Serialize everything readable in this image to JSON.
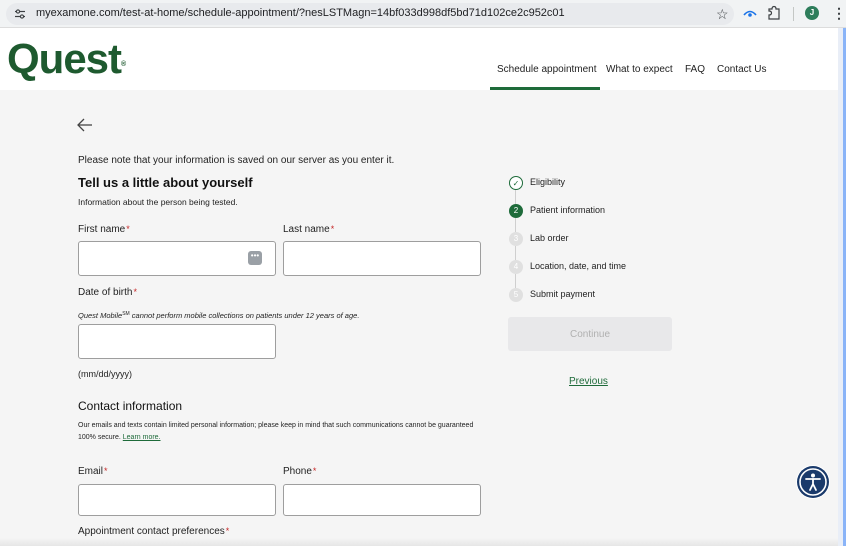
{
  "browser": {
    "url": "myexamone.com/test-at-home/schedule-appointment/?nesLSTMagn=14bf033d998df5bd71d102ce2c952c01",
    "profile_initial": "J"
  },
  "header": {
    "logo": "Quest",
    "logo_mark": "®",
    "nav": [
      {
        "label": "Schedule appointment",
        "active": true
      },
      {
        "label": "What to expect",
        "active": false
      },
      {
        "label": "FAQ",
        "active": false
      },
      {
        "label": "Contact Us",
        "active": false
      }
    ]
  },
  "form": {
    "save_note": "Please note that your information is saved on our server as you enter it.",
    "title": "Tell us a little about yourself",
    "subtitle": "Information about the person being tested.",
    "required_mark": "*",
    "first_name_label": "First name",
    "first_name_value": "",
    "last_name_label": "Last name",
    "last_name_value": "",
    "dob_label": "Date of birth",
    "mobile_note_prefix": "Quest Mobile",
    "mobile_note_tm": "SM",
    "mobile_note_suffix": " cannot perform mobile collections on patients under 12 years of age.",
    "dob_value": "",
    "dob_format": "(mm/dd/yyyy)",
    "contact_title": "Contact information",
    "contact_note": "Our emails and texts contain limited personal information; please keep in mind that such communications cannot be guaranteed 100% secure.",
    "learn_more": "Learn more.",
    "email_label": "Email",
    "email_value": "",
    "phone_label": "Phone",
    "phone_value": "",
    "contact_pref_label": "Appointment contact preferences",
    "autofill_icon": "password-manager-icon"
  },
  "stepper": {
    "steps": [
      {
        "number": "1",
        "label": "Eligibility",
        "status": "complete"
      },
      {
        "number": "2",
        "label": "Patient information",
        "status": "active"
      },
      {
        "number": "3",
        "label": "Lab order",
        "status": "pending"
      },
      {
        "number": "4",
        "label": "Location, date, and time",
        "status": "pending"
      },
      {
        "number": "5",
        "label": "Submit payment",
        "status": "pending"
      }
    ],
    "continue_label": "Continue",
    "previous_label": "Previous"
  },
  "colors": {
    "brand_green": "#1e6b3a",
    "logo_green": "#1e5a2f",
    "required_red": "#c62828",
    "accessibility_navy": "#1a3a6b"
  }
}
